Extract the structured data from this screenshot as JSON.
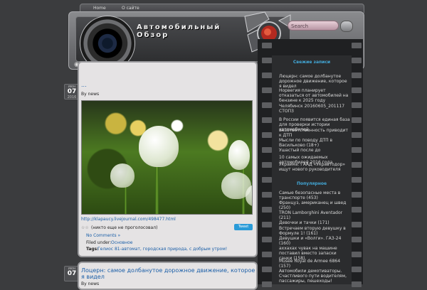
{
  "nav": {
    "home": "Home",
    "about": "О сайте"
  },
  "site": {
    "title": "Автомобильный Обзор",
    "rss_icon": "rss-icon"
  },
  "search": {
    "placeholder": "Search"
  },
  "post1": {
    "date_month": "июн",
    "date_day": "07",
    "date_year": "2016",
    "title": "...",
    "author": "By news",
    "link": "http://klapaucy.livejournal.com/498477.html",
    "rating": "(никто еще не проголосовал)",
    "tweet": "Tweet",
    "comments": "No Comments »",
    "filed_label": "Filed under:",
    "category": "Основное",
    "tags_label": "Tags:",
    "tags": "Гелиос 81-автомат, городская природа, с добрым утром!"
  },
  "post2": {
    "date_month": "июн",
    "date_day": "07",
    "title": "Лоцерн: самое долбанутое дорожное движение, которое я видел",
    "author": "By news"
  },
  "sidebar": {
    "fresh_title": "Свежие записи",
    "fresh": [
      "Люцерн: самое долбанутое дорожное движение, которое я видел",
      "Норвегия планирует отказаться от автомобилей на бензине к 2025 году",
      "Челябинск 20160605_201117 СТОП3",
      "В России появится единая база для проверки истории автомобилей",
      "Безответственность приводит к ДТП",
      "Мысли по поводу ДТП в Васильково (18+)",
      "Ушастый после до",
      "10 самых ожидаемых автомобилей 2016 года",
      "Украина: ГААД «Укравтодор» ищут нового руководителя"
    ],
    "popular_title": "Популярное",
    "popular": [
      "Самые безопасные места в транспорте (453)",
      "Француз, американец и швед (250)",
      "TRON Lamborghini Aventador (211)",
      "Девочки и тачки (171)",
      "Встречаем вторую девушку в Формуле 1! (161)",
      "Девушки и «Волги». ГАЗ-24 (160)",
      "аххахах чувак на машине поставил вместо запаски санки (158)",
      "Musee Royal de Armee 6864 (157)",
      "Автомобили демотиваторы. Счастливого пути водителям, пассажиры, пешеходы!"
    ]
  }
}
